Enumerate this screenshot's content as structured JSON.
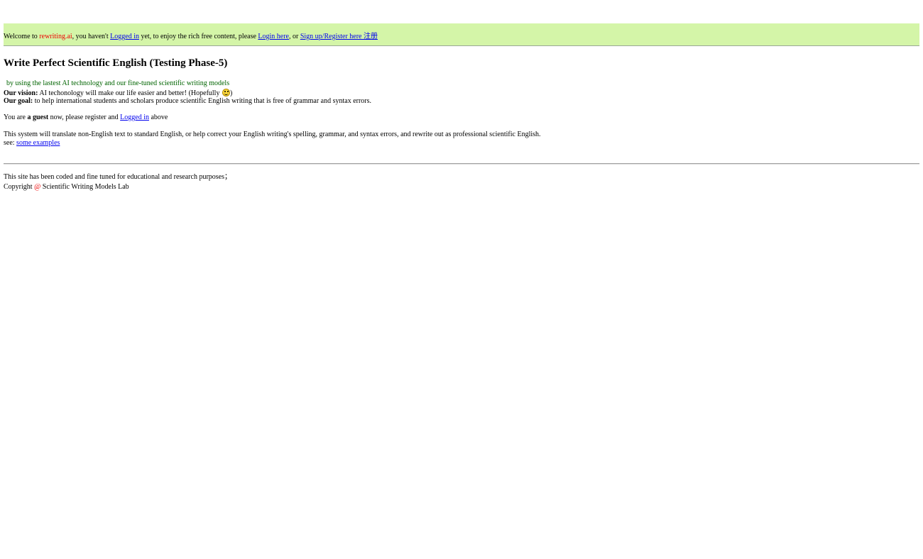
{
  "header": {
    "welcome_prefix": "Welcome to ",
    "brand": "rewriting.ai",
    "not_logged_text": ", you haven't ",
    "logged_in_link": "Logged in",
    "enjoy_text": " yet, to enjoy the rich free content, please ",
    "login_link": "Login here",
    "or_text": ", or ",
    "signup_link": "Sign up/Register here 注册"
  },
  "main": {
    "title": "Write Perfect Scientific English (Testing Phase-5)",
    "subtitle": "by using the lastest AI technology and our fine-tuned scientific writing models",
    "vision_label": "Our vision:",
    "vision_text": " AI techonology will make our life easier and better! (Hopefully ",
    "vision_close": ")",
    "goal_label": "Our goal:",
    "goal_text": " to help international students and scholars produce scientific English writing that is free of grammar and syntax errors.",
    "guest_prefix": "You are ",
    "guest_bold": "a guest",
    "guest_middle": " now, please register and ",
    "guest_link": "Logged in",
    "guest_suffix": " above",
    "system_text": "This system will translate non-English text to standard English, or help correct your English writing's spelling, grammar, and syntax errors, and rewrite out as professional scientific English.",
    "see_label": "see: ",
    "examples_link": "some examples"
  },
  "footer": {
    "purpose_text": "This site has been coded and fine tuned for educational and research purposes；",
    "copyright_label": "Copyright ",
    "at_symbol": "@",
    "lab_name": " Scientific Writing Models Lab"
  },
  "icons": {
    "vision_emoji": "smiley-face-icon"
  },
  "colors": {
    "topbar_bg": "#d4f5a8",
    "brand": "#ee0000",
    "link": "#0000ee",
    "subtitle": "#006400"
  }
}
